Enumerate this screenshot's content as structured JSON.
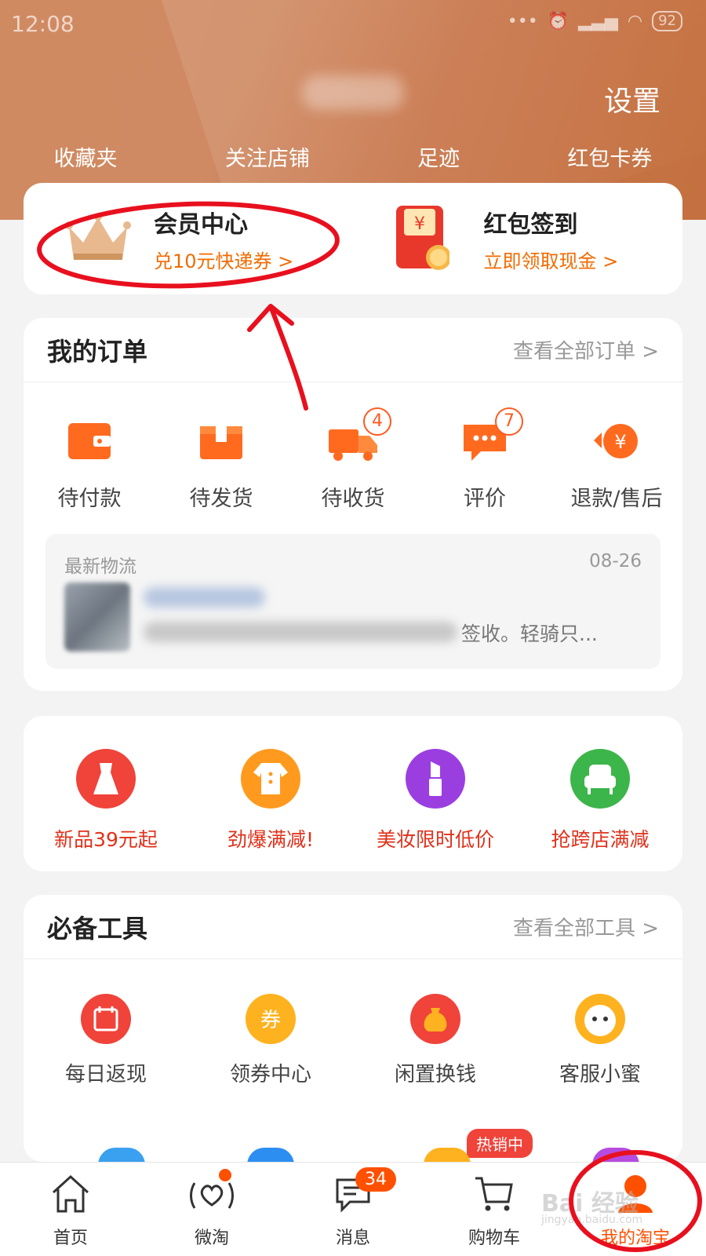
{
  "status_bar": {
    "time": "12:08",
    "battery": "92"
  },
  "header": {
    "settings_label": "设置",
    "quick_links": [
      "收藏夹",
      "关注店铺",
      "足迹",
      "红包卡券"
    ]
  },
  "promo": {
    "member": {
      "title": "会员中心",
      "subtitle": "兑10元快递券 >"
    },
    "red_packet": {
      "title": "红包签到",
      "subtitle": "立即领取现金 >",
      "symbol": "¥"
    }
  },
  "orders": {
    "title": "我的订单",
    "view_all": "查看全部订单 >",
    "items": [
      {
        "label": "待付款",
        "icon": "wallet-icon",
        "badge": ""
      },
      {
        "label": "待发货",
        "icon": "package-icon",
        "badge": ""
      },
      {
        "label": "待收货",
        "icon": "truck-icon",
        "badge": "4"
      },
      {
        "label": "评价",
        "icon": "comment-icon",
        "badge": "7"
      },
      {
        "label": "退款/售后",
        "icon": "refund-icon",
        "badge": ""
      }
    ],
    "logistics": {
      "label": "最新物流",
      "date": "08-26",
      "text": "签收。轻骑只..."
    }
  },
  "promo_grid": [
    {
      "label": "新品39元起",
      "icon": "dress-icon",
      "color": "#f0433a"
    },
    {
      "label": "劲爆满减!",
      "icon": "baby-clothes-icon",
      "color": "#ff9a1f"
    },
    {
      "label": "美妆限时低价",
      "icon": "lipstick-icon",
      "color": "#9b3ee0"
    },
    {
      "label": "抢跨店满减",
      "icon": "armchair-icon",
      "color": "#3cb54a"
    }
  ],
  "tools": {
    "title": "必备工具",
    "view_all": "查看全部工具 >",
    "items": [
      {
        "label": "每日返现",
        "icon": "calendar-cash-icon",
        "color": "#f0433a"
      },
      {
        "label": "领券中心",
        "icon": "coupon-icon",
        "color": "#ffb21f",
        "glyph": "券"
      },
      {
        "label": "闲置换钱",
        "icon": "money-bag-icon",
        "color": "#f0433a"
      },
      {
        "label": "客服小蜜",
        "icon": "assistant-bee-icon",
        "color": "#ffb21f"
      }
    ],
    "hot_badge": "热销中"
  },
  "tabbar": [
    {
      "label": "首页",
      "icon": "home-icon",
      "active": false
    },
    {
      "label": "微淘",
      "icon": "weitao-icon",
      "active": false,
      "dot": true
    },
    {
      "label": "消息",
      "icon": "message-icon",
      "active": false,
      "count": "34"
    },
    {
      "label": "购物车",
      "icon": "cart-icon",
      "active": false
    },
    {
      "label": "我的淘宝",
      "icon": "profile-icon",
      "active": true
    }
  ],
  "watermark": {
    "main": "Bai 经验",
    "sub": "jingyan.baidu.com"
  },
  "colors": {
    "accent": "#ff5000",
    "orange_text": "#f26b00",
    "header": "#cf8a63",
    "annotation": "#e8101e"
  }
}
